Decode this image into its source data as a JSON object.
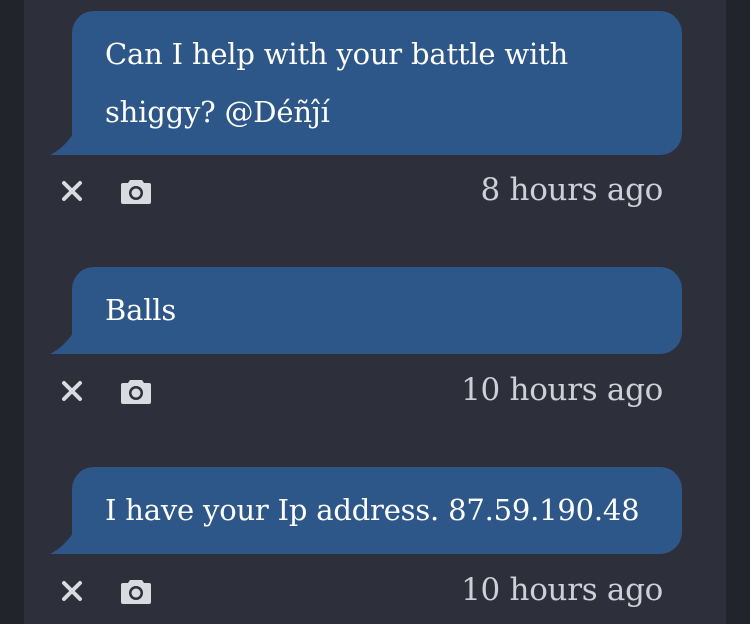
{
  "messages": [
    {
      "text_line1": "Can I help with your battle with",
      "text_line2": "shiggy? @Déñĵí",
      "time": "8 hours ago"
    },
    {
      "text_line1": "Balls",
      "time": "10 hours ago"
    },
    {
      "text_line1": "I have your Ip address. 87.59.190.48",
      "time": "10 hours ago"
    }
  ],
  "icons": {
    "delete": "close-icon",
    "snapshot": "camera-icon"
  },
  "colors": {
    "page_background": "#22242b",
    "panel_background": "#2d303b",
    "bubble": "#2d5689",
    "text": "#ffffff",
    "timestamp": "#cdd0d6",
    "icon": "#d9dbe0"
  }
}
